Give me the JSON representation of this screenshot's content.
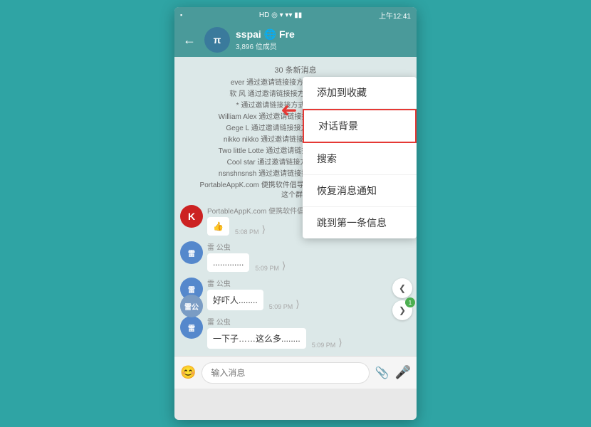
{
  "statusBar": {
    "left": "▪",
    "time": "上午12:41",
    "icons": "HD ◎ ▾ ▾▾ ▾▾ ■■"
  },
  "header": {
    "backLabel": "←",
    "avatarLabel": "π",
    "name": "sspai 🌐 Fre",
    "subtitle": "3,896 位成员",
    "nameShort": "sspai"
  },
  "chat": {
    "newMessagesBadge": "30 条新消息",
    "systemMessages": [
      "ever 通过邀请链接接方式加入了这个群组",
      "软 风 通过邀请链接方式加入了这个群组",
      "* 通过邀请链接接方式加入了这个群组",
      "William Alex 通过邀请链接接方式加入了这个群组",
      "Gege L 通过邀请链接接方式加入了这个群组",
      "nikko nikko 通过邀请链接方式加入了这个群组",
      "Two little Lotte 通过邀请链接方式加入了这个群组",
      "Cool star 通过邀请链接方式加入了这个群组",
      "nsnshnsnsh 通过邀请链接接方式加入了这个群组",
      "PortableAppK.com 便携软件倡导者 通过邀请链接方式加入了这个群组"
    ],
    "messages": [
      {
        "id": 1,
        "sender": "PortableAppK.com 便携软件倡导者",
        "avatar": "K",
        "avatarBg": "#cc2222",
        "text": "👍",
        "time": "5:08 PM"
      },
      {
        "id": 2,
        "sender": "雷 公虫",
        "avatar": "雷",
        "avatarBg": "#5588cc",
        "text": ".............",
        "time": "5:09 PM"
      },
      {
        "id": 3,
        "sender": "雷 公虫",
        "avatar": "雷",
        "avatarBg": "#5588cc",
        "text": "好吓人........",
        "time": "5:09 PM"
      },
      {
        "id": 4,
        "sender": "雷 公虫",
        "avatar": "雷",
        "avatarBg": "#5588cc",
        "text": "一下子……这么多........",
        "time": "5:09 PM"
      }
    ]
  },
  "menu": {
    "items": [
      {
        "id": "add-favorite",
        "label": "添加到收藏",
        "highlighted": false
      },
      {
        "id": "chat-bg",
        "label": "对话背景",
        "highlighted": true
      },
      {
        "id": "search",
        "label": "搜索",
        "highlighted": false
      },
      {
        "id": "restore-notify",
        "label": "恢复消息通知",
        "highlighted": false
      },
      {
        "id": "jump-first",
        "label": "跳到第一条信息",
        "highlighted": false
      }
    ]
  },
  "inputBar": {
    "placeholder": "输入消息",
    "emojiIcon": "😊",
    "attachIcon": "📎",
    "micIcon": "🎤"
  },
  "bottomAvatar": {
    "label": "雷公"
  },
  "scrollButtons": {
    "upIcon": "❮",
    "downIcon": "❯",
    "count": "1"
  }
}
